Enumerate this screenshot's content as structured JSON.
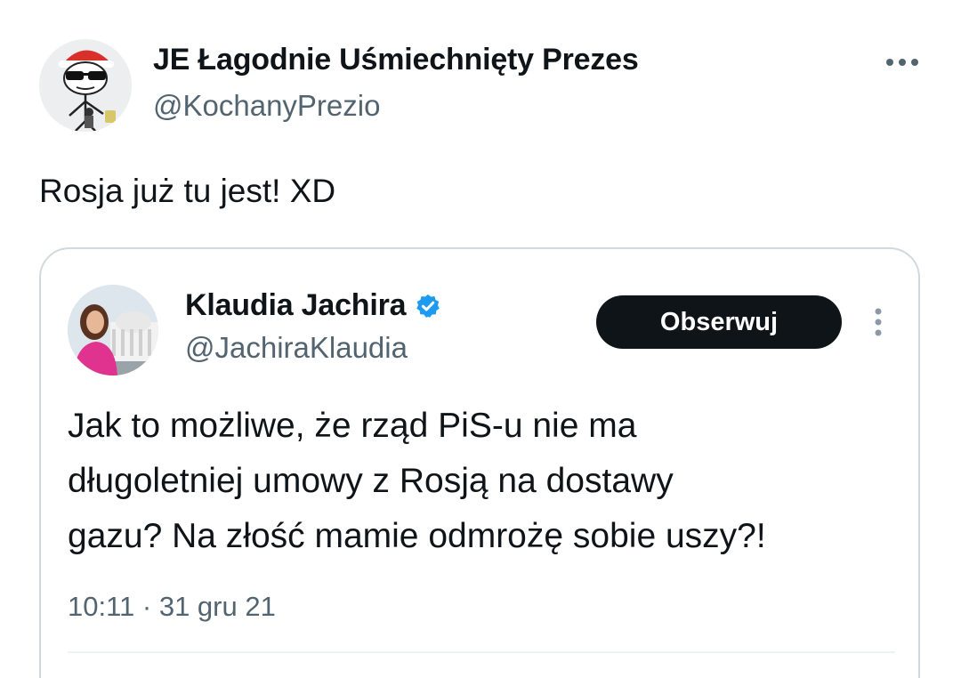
{
  "author": {
    "name": "JE Łagodnie Uśmiechnięty Prezes",
    "handle": "@KochanyPrezio"
  },
  "tweet": {
    "text": "Rosja już tu jest! XD"
  },
  "quoted_tweet": {
    "author_name": "Klaudia Jachira",
    "author_handle": "@JachiraKlaudia",
    "verified": true,
    "follow_label": "Obserwuj",
    "text_lines": [
      "Jak to możliwe, że rząd PiS-u nie ma",
      "długoletniej umowy z Rosją na dostawy",
      "gazu? Na złość mamie odmrożę sobie uszy?!"
    ],
    "timestamp": "10:11 · 31 gru 21"
  },
  "icons": {
    "more": "more-horizontal-icon",
    "quote_more": "more-vertical-icon",
    "verified": "verified-badge-icon"
  },
  "colors": {
    "text": "#0f1419",
    "secondary_text": "#536471",
    "border": "#cfd9de",
    "verified_blue": "#1d9bf0",
    "follow_button_bg": "#0f1419"
  }
}
